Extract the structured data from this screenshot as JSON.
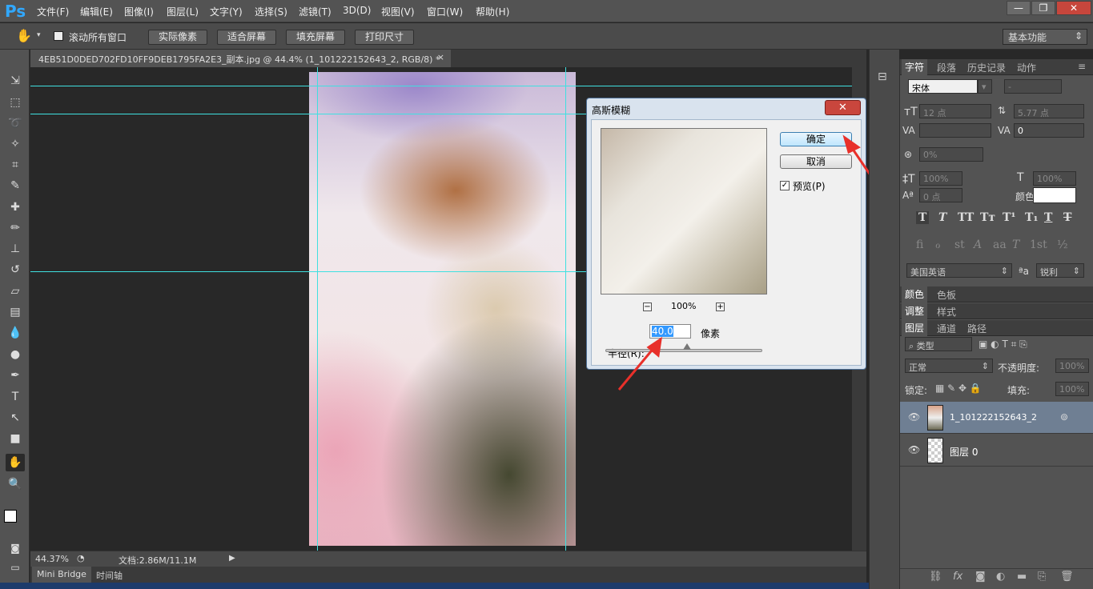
{
  "app": {
    "logo": "Ps"
  },
  "menu": [
    "文件(F)",
    "编辑(E)",
    "图像(I)",
    "图层(L)",
    "文字(Y)",
    "选择(S)",
    "滤镜(T)",
    "3D(D)",
    "视图(V)",
    "窗口(W)",
    "帮助(H)"
  ],
  "window_controls": {
    "minimize": "—",
    "restore": "❐",
    "close": "✕"
  },
  "options": {
    "scroll_all_label": "滚动所有窗口",
    "actual_pixels": "实际像素",
    "fit_screen": "适合屏幕",
    "fill_screen": "填充屏幕",
    "print_size": "打印尺寸",
    "workspace": "基本功能"
  },
  "document": {
    "tab_title": "4EB51D0DED702FD10FF9DEB1795FA2E3_副本.jpg @ 44.4% (1_101222152643_2, RGB/8) *",
    "close": "×"
  },
  "status": {
    "zoom": "44.37%",
    "doc_info": "文档:2.86M/11.1M"
  },
  "bottom_tabs": [
    "Mini Bridge",
    "时间轴"
  ],
  "dialog": {
    "title": "高斯模糊",
    "close": "✕",
    "ok": "确定",
    "cancel": "取消",
    "preview_label": "预览(P)",
    "preview_checked": true,
    "zoom_level": "100%",
    "zoom_out": "−",
    "zoom_in": "+",
    "radius_label": "半径(R):",
    "radius_value": "40.0",
    "radius_unit": "像素",
    "slider_position": 0.52
  },
  "character_panel": {
    "tabs": [
      "字符",
      "段落",
      "历史记录",
      "动作"
    ],
    "font_family": "宋体",
    "font_style": "-",
    "font_size": "12 点",
    "leading": "5.77 点",
    "tracking": "0",
    "scale": "0%",
    "vscale": "100%",
    "hscale": "100%",
    "baseline": "0 点",
    "color_label": "颜色:",
    "language": "美国英语",
    "aa_label": "ªa",
    "antialias": "锐利"
  },
  "color_panel": {
    "tabs": [
      "颜色",
      "色板"
    ]
  },
  "adjust_panel": {
    "tabs": [
      "调整",
      "样式"
    ]
  },
  "layers_panel": {
    "tabs": [
      "图层",
      "通道",
      "路径"
    ],
    "filter_kind": "类型",
    "blend_mode": "正常",
    "opacity_label": "不透明度:",
    "opacity": "100%",
    "lock_label": "锁定:",
    "fill_label": "填充:",
    "fill": "100%",
    "layers": [
      {
        "name": "1_101222152643_2",
        "selected": true
      },
      {
        "name": "图层 0",
        "selected": false
      }
    ]
  },
  "colors": {
    "accent": "#31a8ff",
    "guide": "#3fe0e0",
    "arrow": "#e8302a"
  }
}
